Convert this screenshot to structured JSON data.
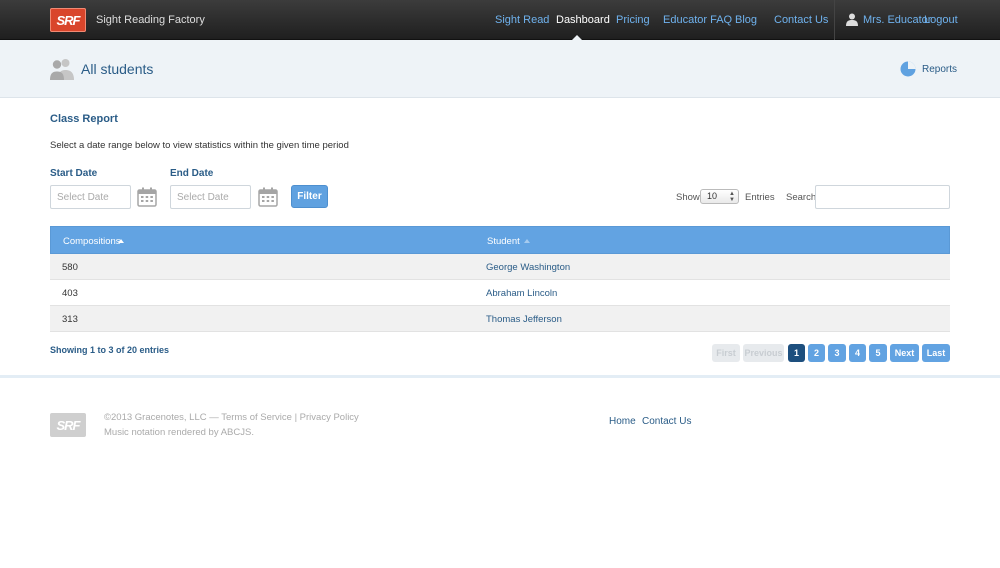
{
  "navbar": {
    "logo_text": "SRF",
    "brand": "Sight Reading Factory",
    "links": [
      "Sight Read",
      "Dashboard",
      "Pricing",
      "Educator FAQ",
      "Blog",
      "Contact Us"
    ],
    "active": "Dashboard",
    "user_name": "Mrs. Educator",
    "logout": "Logout"
  },
  "subheader": {
    "title": "All students",
    "reports": "Reports"
  },
  "report": {
    "title": "Class Report",
    "instruction": "Select a date range below to view statistics within the given time period",
    "start_label": "Start Date",
    "end_label": "End Date",
    "start_placeholder": "Select Date",
    "end_placeholder": "Select Date",
    "filter_label": "Filter",
    "show_label": "Show",
    "entries_value": "10",
    "entries_label": "Entries",
    "search_label": "Search:"
  },
  "table": {
    "columns": [
      "Compositions",
      "Student"
    ],
    "rows": [
      {
        "compositions": "580",
        "student": "George Washington"
      },
      {
        "compositions": "403",
        "student": "Abraham Lincoln"
      },
      {
        "compositions": "313",
        "student": "Thomas Jefferson"
      }
    ]
  },
  "pagination": {
    "showing": "Showing 1 to 3 of 20 entries",
    "first": "First",
    "previous": "Previous",
    "pages": [
      "1",
      "2",
      "3",
      "4",
      "5"
    ],
    "current": "1",
    "next": "Next",
    "last": "Last"
  },
  "footer": {
    "logo_text": "SRF",
    "copyright": "©2013 Gracenotes, LLC — Terms of Service | Privacy Policy",
    "notation": "Music notation rendered by ABCJS.",
    "links": [
      "Home",
      "Contact Us"
    ]
  },
  "colors": {
    "accent": "#62a3e2",
    "nav_link": "#6fb2ee",
    "heading": "#2a5c87",
    "logo": "#d9452b",
    "current_page": "#1d4f7e"
  },
  "icons": [
    "user-icon",
    "students-icon",
    "pie-chart-icon",
    "calendar-icon",
    "sort-asc-icon"
  ]
}
